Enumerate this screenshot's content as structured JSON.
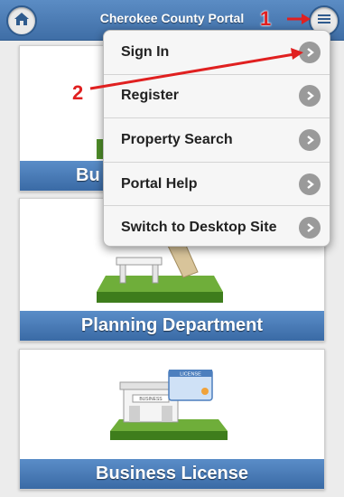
{
  "header": {
    "title": "Cherokee County Portal",
    "home_icon": "home-icon",
    "menu_icon": "hamburger-menu-icon"
  },
  "annotations": {
    "one": "1",
    "two": "2",
    "arrow_color": "#e02020"
  },
  "menu": {
    "items": [
      {
        "label": "Sign In"
      },
      {
        "label": "Register"
      },
      {
        "label": "Property Search"
      },
      {
        "label": "Portal Help"
      },
      {
        "label": "Switch to Desktop Site"
      }
    ]
  },
  "cards": [
    {
      "label": "Bu",
      "icon": "building-icon"
    },
    {
      "label": "Planning Department",
      "icon": "planning-bench-icon"
    },
    {
      "label": "Business License",
      "icon": "business-license-icon"
    }
  ],
  "colors": {
    "header": "#3f6ea6",
    "card_label": "#3a6aa5",
    "menu_bg": "#f6f6f6"
  }
}
